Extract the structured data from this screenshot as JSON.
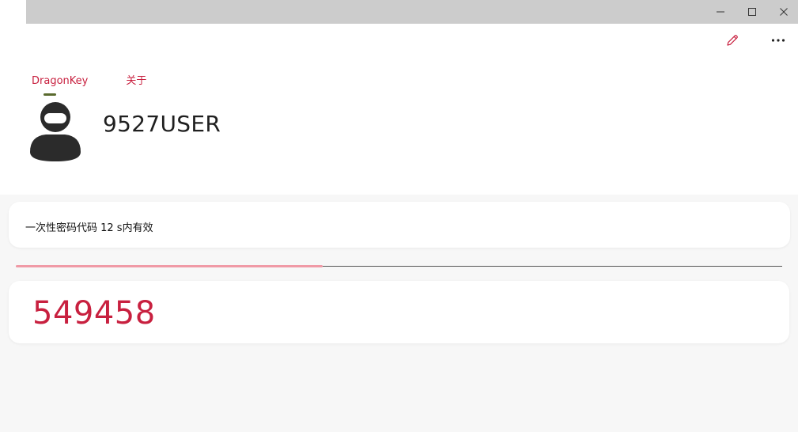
{
  "window": {
    "controls": {
      "minimize": "—",
      "maximize": "☐",
      "close": "✕"
    }
  },
  "toolbar": {
    "edit_icon": "pencil-icon",
    "more_icon": "more-icon",
    "more_label": "···"
  },
  "tabs": [
    {
      "label": "DragonKey",
      "active": true
    },
    {
      "label": "关于",
      "active": false
    }
  ],
  "account": {
    "avatar_icon": "user-avatar-icon",
    "username": "9527USER"
  },
  "otp": {
    "validity_text": "一次性密码代码 12 s内有效",
    "remaining_fraction": 0.4,
    "code": "549458"
  },
  "colors": {
    "accent": "#c8203f",
    "progress_fill": "#f09aa6",
    "tab_indicator": "#5a6a2e",
    "titlebar": "#cccccc"
  }
}
